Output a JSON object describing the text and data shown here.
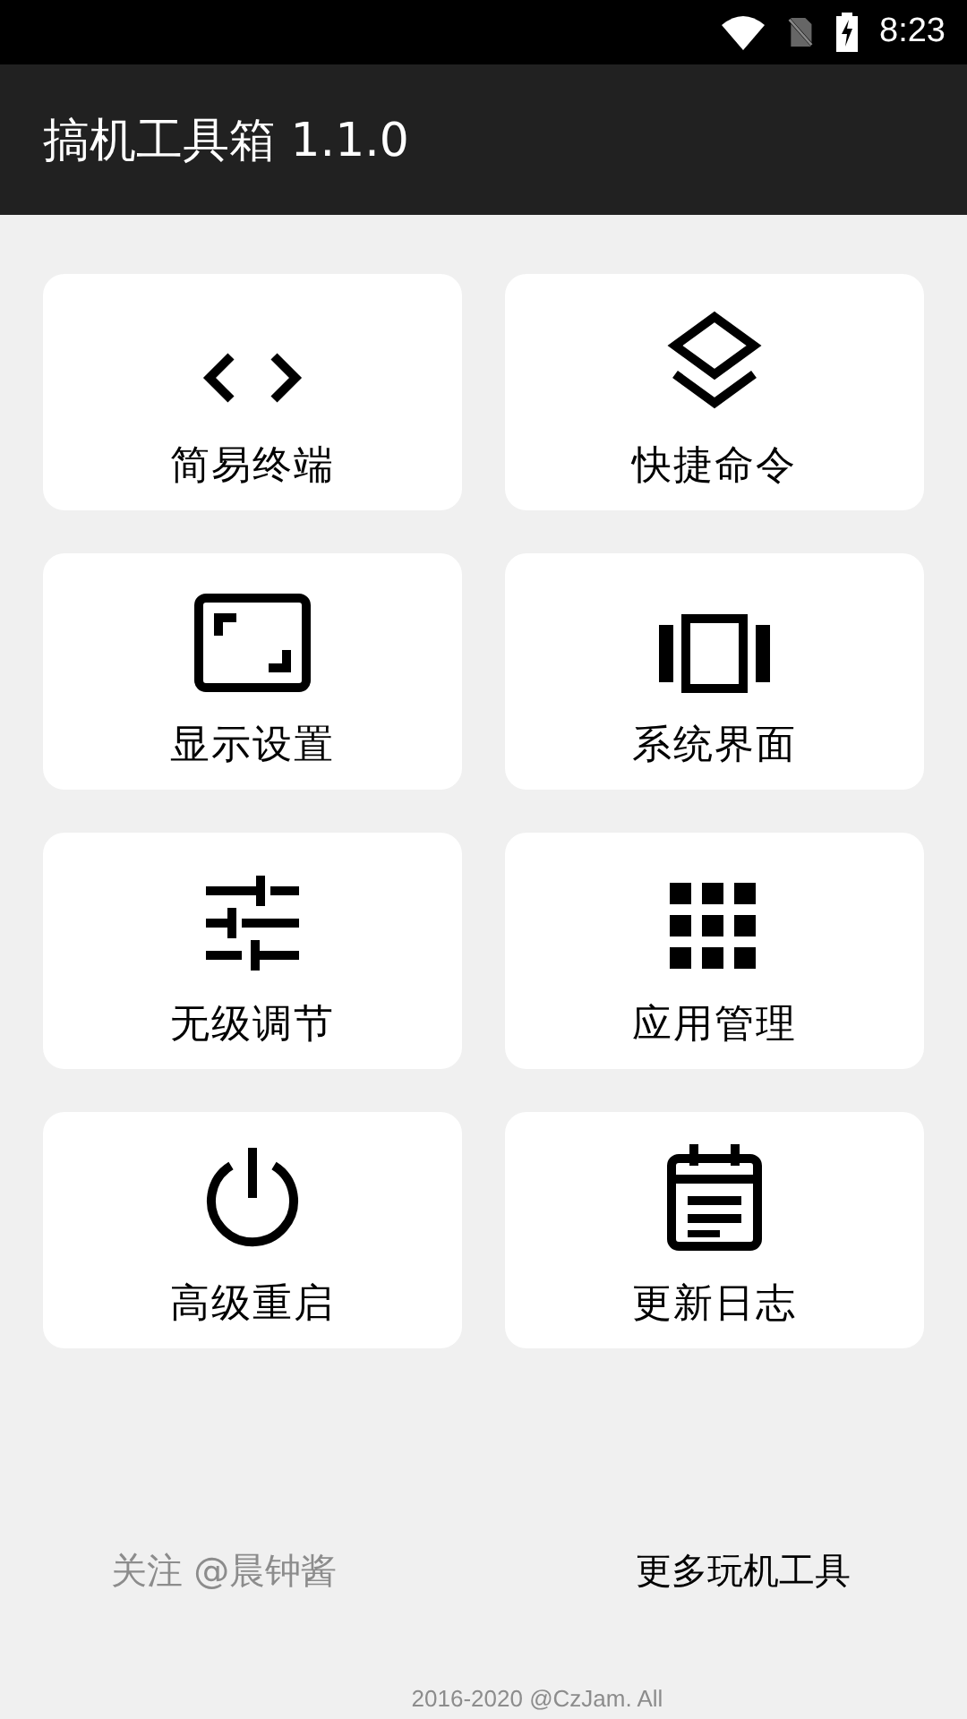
{
  "status_bar": {
    "time": "8:23"
  },
  "app_bar": {
    "title": "搞机工具箱 1.1.0"
  },
  "tiles": [
    {
      "label": "简易终端"
    },
    {
      "label": "快捷命令"
    },
    {
      "label": "显示设置"
    },
    {
      "label": "系统界面"
    },
    {
      "label": "无级调节"
    },
    {
      "label": "应用管理"
    },
    {
      "label": "高级重启"
    },
    {
      "label": "更新日志"
    }
  ],
  "footer": {
    "follow_link": "关注 @晨钟酱",
    "more_link": "更多玩机工具",
    "copyright": "2016-2020 @CzJam. All"
  }
}
